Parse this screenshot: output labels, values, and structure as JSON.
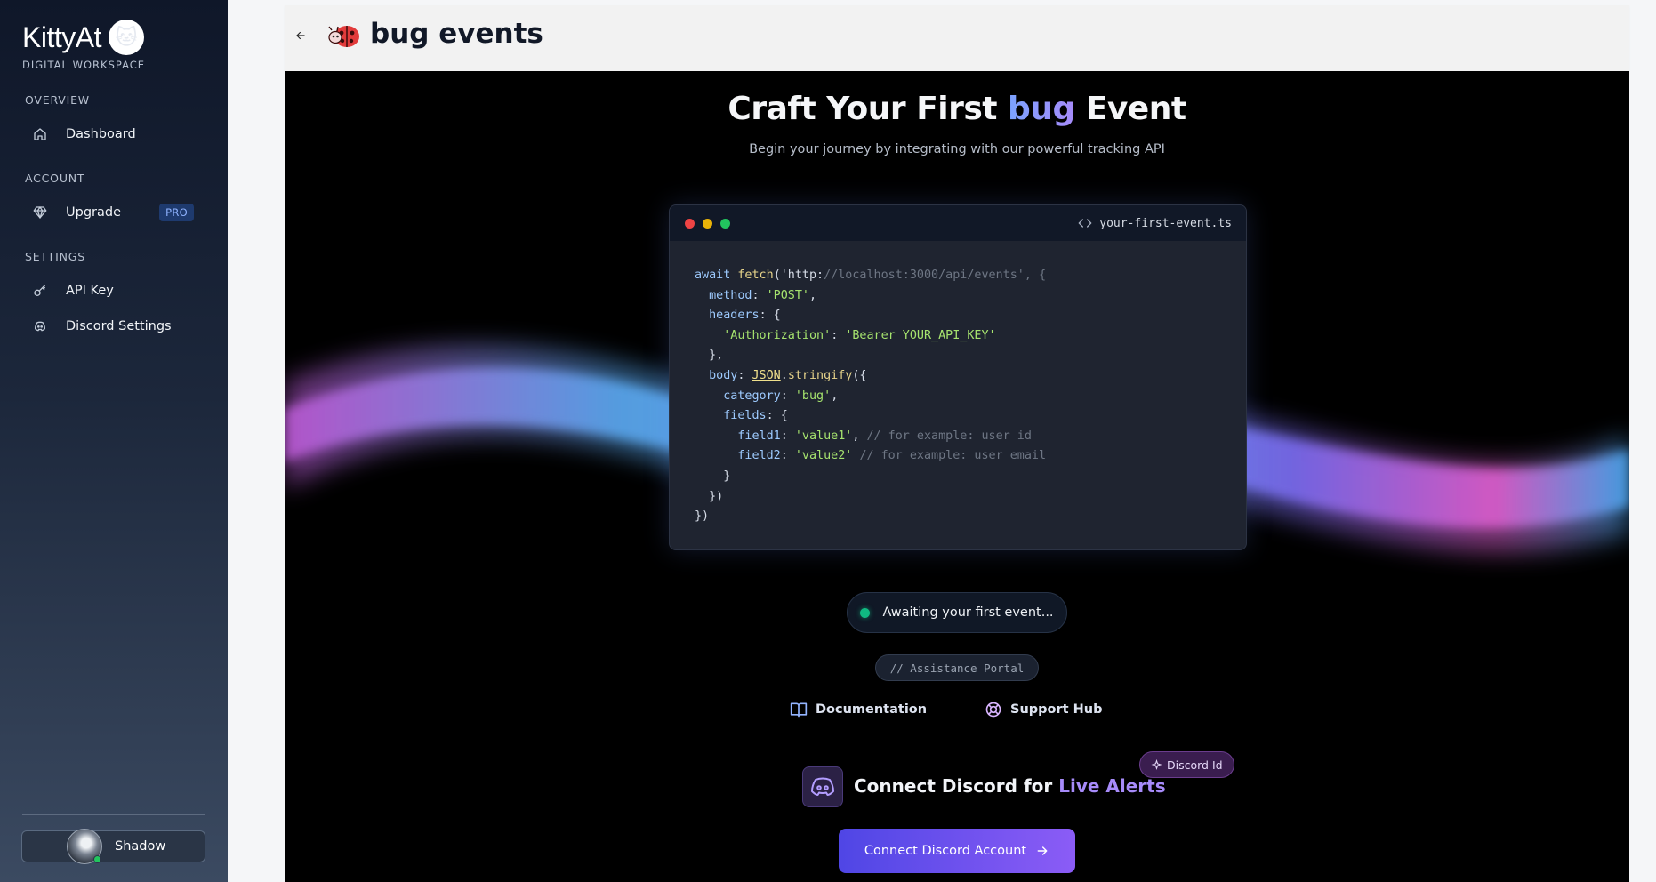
{
  "sidebar": {
    "brand_name": "KittyAt",
    "brand_sub": "DIGITAL WORKSPACE",
    "sections": [
      {
        "label": "OVERVIEW"
      },
      {
        "label": "ACCOUNT"
      },
      {
        "label": "SETTINGS"
      }
    ],
    "items": [
      {
        "label": "Dashboard",
        "icon": "home-icon"
      },
      {
        "label": "Upgrade",
        "icon": "gem-icon",
        "badge": "PRO"
      },
      {
        "label": "API Key",
        "icon": "key-icon"
      },
      {
        "label": "Discord Settings",
        "icon": "discord-icon"
      }
    ],
    "user": {
      "name": "Shadow",
      "status": "online"
    }
  },
  "header": {
    "title": "bug events",
    "icon": "ladybug-icon"
  },
  "hero": {
    "title_pre": "Craft Your First ",
    "title_accent": "bug",
    "title_post": " Event",
    "subtitle": "Begin your journey by integrating with our powerful tracking API"
  },
  "code": {
    "filename": "your-first-event.ts",
    "lines": [
      "await fetch('http://localhost:3000/api/events', {",
      "  method: 'POST',",
      "  headers: {",
      "    'Authorization': 'Bearer YOUR_API_KEY'",
      "  },",
      "  body: JSON.stringify({",
      "    category: 'bug',",
      "    fields: {",
      "      field1: 'value1', // for example: user id",
      "      field2: 'value2' // for example: user email",
      "    }",
      "  })",
      "})"
    ]
  },
  "status": {
    "text": "Awaiting your first event..."
  },
  "assistance": {
    "chip": "// Assistance Portal",
    "documentation": "Documentation",
    "support": "Support Hub"
  },
  "discord": {
    "title_pre": "Connect Discord for ",
    "title_accent": "Live Alerts",
    "chip": "Discord Id",
    "button": "Connect Discord Account"
  },
  "colors": {
    "accent": "#8b5cf6",
    "status_green": "#10b981",
    "sidebar_bg": "#1c273b"
  }
}
